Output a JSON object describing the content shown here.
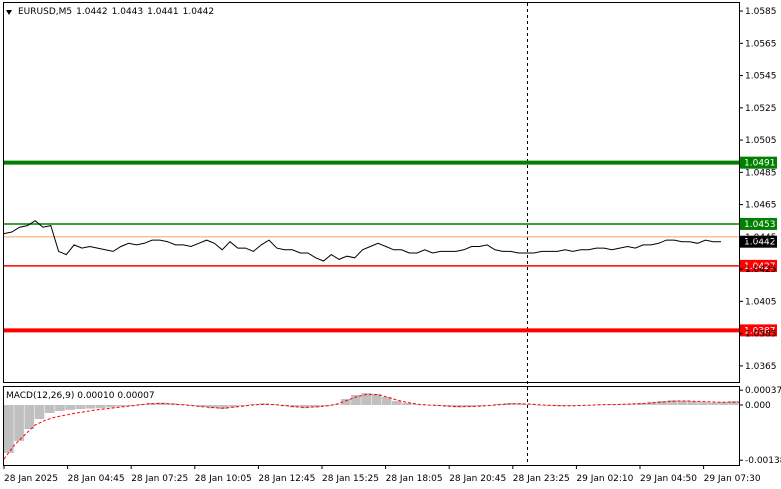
{
  "header": {
    "symbol": "EURUSD,M5",
    "open": "1.0442",
    "high": "1.0443",
    "low": "1.0441",
    "close": "1.0442"
  },
  "macd": {
    "label": "MACD(12,26,9)",
    "main": "0.00010",
    "signal": "0.00007",
    "axis_labels": [
      "0.00037",
      "0.000",
      "-0.00138"
    ]
  },
  "price_axis": {
    "ticks": [
      "1.0585",
      "1.0565",
      "1.0545",
      "1.0525",
      "1.0505",
      "1.0485",
      "1.0465",
      "1.0445",
      "1.0425",
      "1.0405",
      "1.0385",
      "1.0365"
    ]
  },
  "levels": [
    {
      "price": 1.0491,
      "label": "1.0491",
      "color": "#008000",
      "width": "thick"
    },
    {
      "price": 1.0453,
      "label": "1.0453",
      "color": "#008000",
      "width": "thin"
    },
    {
      "price": 1.0427,
      "label": "1.0427",
      "color": "#ff0000",
      "width": "thin"
    },
    {
      "price": 1.0387,
      "label": "1.0387",
      "color": "#ff0000",
      "width": "thick"
    }
  ],
  "current_price": {
    "value": 1.0442,
    "label": "1.0442"
  },
  "time_axis": {
    "labels": [
      "28 Jan 2025",
      "28 Jan 04:45",
      "28 Jan 07:25",
      "28 Jan 10:05",
      "28 Jan 12:45",
      "28 Jan 15:25",
      "28 Jan 18:05",
      "28 Jan 20:45",
      "28 Jan 23:25",
      "29 Jan 02:10",
      "29 Jan 04:50",
      "29 Jan 07:30"
    ]
  },
  "chart_data": {
    "type": "line",
    "y_range": [
      1.0355,
      1.059
    ],
    "price_series": [
      1.0447,
      1.0448,
      1.0451,
      1.0452,
      1.0455,
      1.0451,
      1.0452,
      1.0436,
      1.0434,
      1.044,
      1.0438,
      1.0439,
      1.0438,
      1.0437,
      1.0436,
      1.0439,
      1.0441,
      1.044,
      1.0441,
      1.0443,
      1.0443,
      1.0442,
      1.044,
      1.044,
      1.0439,
      1.0441,
      1.0443,
      1.0441,
      1.0437,
      1.0442,
      1.0438,
      1.0438,
      1.0436,
      1.044,
      1.0443,
      1.0438,
      1.0437,
      1.0437,
      1.0435,
      1.0435,
      1.0432,
      1.043,
      1.0434,
      1.0431,
      1.0433,
      1.0432,
      1.0437,
      1.0439,
      1.0441,
      1.0439,
      1.0437,
      1.0437,
      1.0435,
      1.0435,
      1.0437,
      1.0435,
      1.0436,
      1.0436,
      1.0436,
      1.0437,
      1.0439,
      1.0439,
      1.044,
      1.0437,
      1.0436,
      1.0436,
      1.0435,
      1.0435,
      1.0435,
      1.0436,
      1.0436,
      1.0436,
      1.0437,
      1.0436,
      1.0437,
      1.0437,
      1.0438,
      1.0438,
      1.0437,
      1.0438,
      1.0439,
      1.0438,
      1.044,
      1.044,
      1.0441,
      1.0443,
      1.0443,
      1.0442,
      1.0442,
      1.0441,
      1.0443,
      1.0442,
      1.0442
    ],
    "macd_hist": [
      -0.0012,
      -0.0009,
      -0.0006,
      -0.00035,
      -0.0002,
      -0.00015,
      -0.00012,
      -0.0001,
      -9e-05,
      -8e-05,
      -6e-05,
      -4e-05,
      -2e-05,
      2e-05,
      5e-05,
      6e-05,
      4e-05,
      2e-05,
      -2e-05,
      -5e-05,
      -8e-05,
      -0.0001,
      -6e-05,
      -2e-05,
      2e-05,
      4e-05,
      2e-05,
      -3e-05,
      -6e-05,
      -8e-05,
      -6e-05,
      -3e-05,
      2e-05,
      0.00015,
      0.00025,
      0.0003,
      0.00028,
      0.0002,
      0.0001,
      5e-05,
      2e-05,
      0.0,
      -2e-05,
      -4e-05,
      -6e-05,
      -5e-05,
      -3e-05,
      0.0,
      3e-05,
      5e-05,
      4e-05,
      2e-05,
      0.0,
      -2e-05,
      -3e-05,
      -2e-05,
      -1e-05,
      0.0,
      1e-05,
      2e-05,
      2e-05,
      3e-05,
      5e-05,
      8e-05,
      0.0001,
      0.00012,
      0.00011,
      9e-05,
      7e-05,
      6e-05,
      8e-05,
      0.0001
    ],
    "macd_signal": [
      -0.00135,
      -0.001,
      -0.00075,
      -0.0005,
      -0.00038,
      -0.0003,
      -0.00025,
      -0.0002,
      -0.00016,
      -0.00012,
      -9e-05,
      -6e-05,
      -3e-05,
      0.0,
      3e-05,
      4e-05,
      3e-05,
      1e-05,
      -1e-05,
      -4e-05,
      -6e-05,
      -8e-05,
      -6e-05,
      -3e-05,
      0.0,
      2e-05,
      1e-05,
      -1e-05,
      -4e-05,
      -6e-05,
      -5e-05,
      -3e-05,
      1e-05,
      0.0001,
      0.0002,
      0.00026,
      0.00026,
      0.0002,
      0.00012,
      6e-05,
      2e-05,
      0.0,
      -1e-05,
      -3e-05,
      -4e-05,
      -4e-05,
      -3e-05,
      -1e-05,
      1e-05,
      3e-05,
      3e-05,
      2e-05,
      0.0,
      -1e-05,
      -2e-05,
      -2e-05,
      -1e-05,
      0.0,
      1e-05,
      1e-05,
      2e-05,
      3e-05,
      4e-05,
      6e-05,
      8e-05,
      0.0001,
      0.0001,
      9e-05,
      8e-05,
      7e-05,
      7e-05,
      7e-05
    ],
    "macd_range": [
      -0.0015,
      0.00045
    ]
  }
}
